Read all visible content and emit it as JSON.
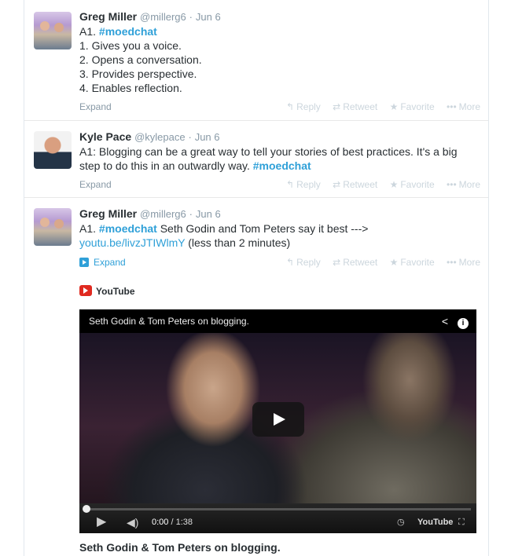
{
  "tweets": [
    {
      "fullname": "Greg Miller",
      "handle": "@millerg6",
      "time": "Jun 6",
      "text_prefix": "A1. ",
      "hashtag": "#moedchat",
      "lines": [
        "1. Gives you a voice.",
        "2. Opens a conversation.",
        "3. Provides perspective.",
        "4. Enables reflection."
      ],
      "expand": "Expand"
    },
    {
      "fullname": "Kyle Pace",
      "handle": "@kylepace",
      "time": "Jun 6",
      "line1": "A1: Blogging can be a great way to tell your stories of best practices. It's a big",
      "line2": "step to do this in an outwardly way.",
      "hashtag": "#moedchat",
      "expand": "Expand"
    },
    {
      "fullname": "Greg Miller",
      "handle": "@millerg6",
      "time": "Jun 6",
      "text_prefix": "A1. ",
      "hashtag": "#moedchat",
      "text_rest": " Seth Godin and Tom Peters say it best --->",
      "link": "youtu.be/livzJTIWlmY",
      "text_suffix": " (less than 2 minutes)",
      "expand": "Expand"
    }
  ],
  "actions": {
    "reply": "Reply",
    "retweet": "Retweet",
    "favorite": "Favorite",
    "more": "More"
  },
  "card": {
    "provider": "YouTube",
    "video_title": "Seth Godin & Tom Peters on blogging.",
    "time_current": "0:00",
    "time_separator": " / ",
    "time_total": "1:38",
    "progress": 0,
    "yt_wordmark": "YouTube",
    "caption": "Seth Godin & Tom Peters on blogging."
  },
  "colors": {
    "link": "#2fa0d8",
    "muted": "#8899a6",
    "action": "#ccd6dd",
    "youtube_red": "#e02a20"
  }
}
